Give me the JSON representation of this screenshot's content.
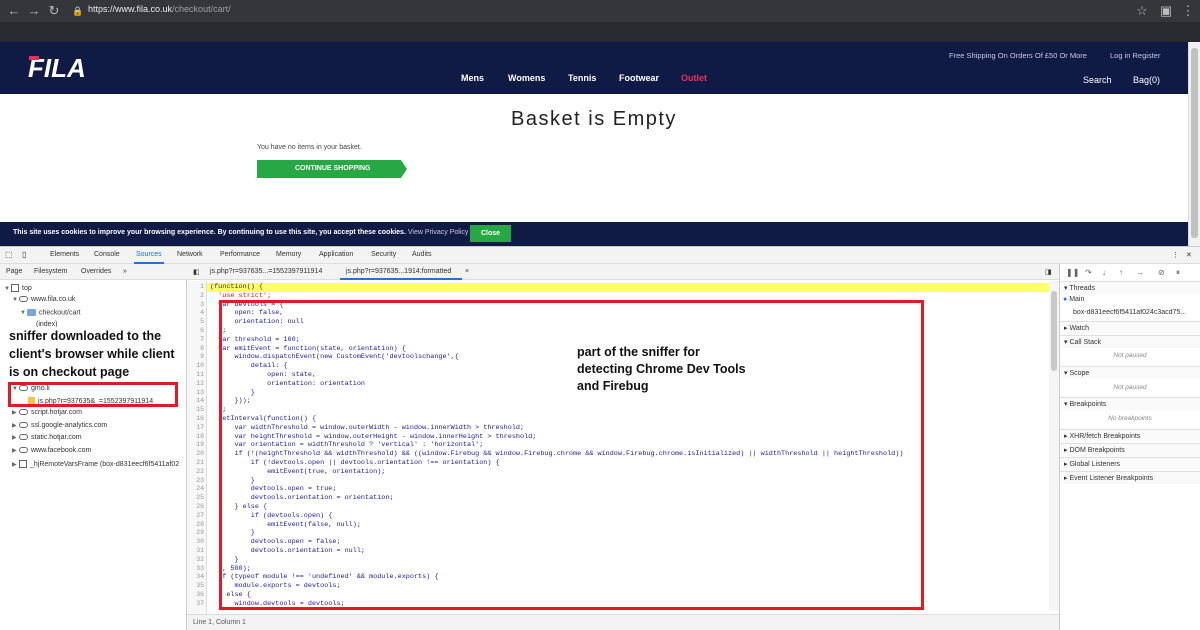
{
  "browser": {
    "url_host": "https://www.fila.co.uk",
    "url_path": "/checkout/cart/"
  },
  "site": {
    "logo_text": "FILA",
    "top_links": [
      "Free Shipping On Orders Of £50 Or More",
      "Log in Register"
    ],
    "nav": [
      "Mens",
      "Womens",
      "Tennis",
      "Footwear",
      "Outlet"
    ],
    "search_label": "Search",
    "bag_label": "Bag(0)",
    "basket_title": "Basket is Empty",
    "basket_message": "You have no items in your basket.",
    "continue_label": "CONTINUE SHOPPING",
    "cookie_text": "This site uses cookies to improve your browsing experience. By continuing to use this site, you accept these cookies.",
    "cookie_link": "View Privacy Policy",
    "cookie_close": "Close",
    "colors": {
      "navy": "#0f1a45",
      "green": "#28a745",
      "outlet": "#e8315a"
    }
  },
  "devtools": {
    "tabs": [
      "Elements",
      "Console",
      "Sources",
      "Network",
      "Performance",
      "Memory",
      "Application",
      "Security",
      "Audits"
    ],
    "active_tab": "Sources",
    "nav_subtabs": [
      "Page",
      "Filesystem",
      "Overrides"
    ],
    "tree": [
      "top",
      "www.fila.co.uk",
      "checkout/cart",
      "(index)",
      "gmo.li",
      "js.php?r=937635&_=1552397911914",
      "script.hotjar.com",
      "ssl.google-analytics.com",
      "static.hotjar.com",
      "www.facebook.com",
      "_hjRemoteVarsFrame (box-d831eecf6f5411af02"
    ],
    "editor_tabs": [
      "js.php?r=937635...=1552397911914",
      "js.php?r=937635...1914:formatted"
    ],
    "status": "Line 1, Column 1",
    "code_lines": [
      "(function() {",
      "  'use strict';",
      "  var devtools = {",
      "      open: false,",
      "      orientation: null",
      "  };",
      "  var threshold = 160;",
      "  var emitEvent = function(state, orientation) {",
      "      window.dispatchEvent(new CustomEvent('devtoolschange',{",
      "          detail: {",
      "              open: state,",
      "              orientation: orientation",
      "          }",
      "      }));",
      "  };",
      "  setInterval(function() {",
      "      var widthThreshold = window.outerWidth - window.innerWidth > threshold;",
      "      var heightThreshold = window.outerHeight - window.innerHeight > threshold;",
      "      var orientation = widthThreshold ? 'vertical' : 'horizontal';",
      "      if (!(heightThreshold && widthThreshold) && ((window.Firebug && window.Firebug.chrome && window.Firebug.chrome.isInitialized) || widthThreshold || heightThreshold))",
      "          if (!devtools.open || devtools.orientation !== orientation) {",
      "              emitEvent(true, orientation);",
      "          }",
      "          devtools.open = true;",
      "          devtools.orientation = orientation;",
      "      } else {",
      "          if (devtools.open) {",
      "              emitEvent(false, null);",
      "          }",
      "          devtools.open = false;",
      "          devtools.orientation = null;",
      "      }",
      "  }, 500);",
      "  if (typeof module !== 'undefined' && module.exports) {",
      "      module.exports = devtools;",
      "  } else {",
      "      window.devtools = devtools;"
    ],
    "debugger": {
      "threads": "Threads",
      "main": "Main",
      "frame": "box-d831eecf6f5411af024c3acd75...",
      "sections": [
        "Watch",
        "Call Stack",
        "Scope",
        "Breakpoints",
        "XHR/fetch Breakpoints",
        "DOM Breakpoints",
        "Global Listeners",
        "Event Listener Breakpoints"
      ],
      "not_paused": "Not paused",
      "no_breakpoints": "No breakpoints"
    }
  },
  "annotations": {
    "left": "sniffer downloaded to the client's browser while client is on checkout page",
    "right": "part of the sniffer for detecting Chrome Dev Tools and Firebug"
  }
}
